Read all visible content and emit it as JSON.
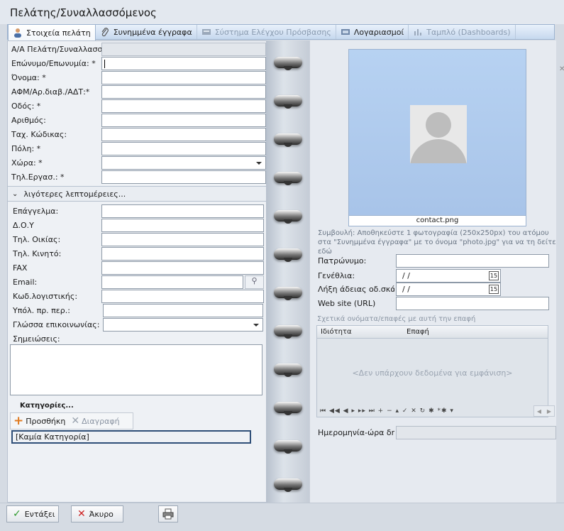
{
  "window": {
    "title": "Πελάτης/Συναλλασσόμενος"
  },
  "tabs": [
    {
      "label": "Στοιχεία πελάτη",
      "icon": "person-icon",
      "active": true
    },
    {
      "label": "Συνημμένα έγγραφα",
      "icon": "paperclip-icon"
    },
    {
      "label": "Σύστημα Ελέγχου Πρόσβασης",
      "icon": "card-reader-icon",
      "disabled": true
    },
    {
      "label": "Λογαριασμοί",
      "icon": "account-icon"
    },
    {
      "label": "Ταμπλό (Dashboards)",
      "icon": "dashboard-icon",
      "disabled": true
    }
  ],
  "main_fields": {
    "id_label": "Α/Α Πελάτη/Συναλλασσόμ",
    "surname_label": "Επώνυμο/Επωνυμία: *",
    "name_label": "Όνομα: *",
    "afm_label": "ΑΦΜ/Αρ.διαβ./ΑΔΤ:*",
    "street_label": "Οδός: *",
    "number_label": "Αριθμός:",
    "zip_label": "Ταχ. Κώδικας:",
    "city_label": "Πόλη: *",
    "country_label": "Χώρα: *",
    "work_phone_label": "Τηλ.Εργασ.: *"
  },
  "details_section": {
    "toggle_label": "λιγότερες λεπτομέρειες...",
    "profession_label": "Επάγγελμα:",
    "doy_label": "Δ.Ο.Υ",
    "home_phone_label": "Τηλ. Οικίας:",
    "mobile_label": "Τηλ. Κινητό:",
    "fax_label": "FAX",
    "email_label": "Email:",
    "accounting_code_label": "Κωδ.λογιστικής:",
    "balance_label": "Υπόλ. πρ. περ.:",
    "language_label": "Γλώσσα επικοινωνίας:",
    "notes_label": "Σημειώσεις:"
  },
  "categories": {
    "header": "Κατηγορίες...",
    "add_label": "Προσθήκη",
    "delete_label": "Διαγραφή",
    "items": [
      "[Καμία Κατηγορία]"
    ]
  },
  "photo": {
    "caption": "contact.png",
    "tip": "Συμβουλή: Αποθηκεύστε 1 φωτογραφία (250x250px) του ατόμου στα \"Συνημμένα έγγραφα\" με το όνομα \"photo.jpg\" για να τη δείτε εδώ"
  },
  "right_fields": {
    "patronymic_label": "Πατρώνυμο:",
    "birthday_label": "Γενέθλια:",
    "birthday_value": "/ /",
    "license_label": "Λήξη άδειας οδ.σκάφους:",
    "license_value": "/ /",
    "website_label": "Web site (URL)",
    "created_label": "Ημερομηνία-ώρα δημιουργίας"
  },
  "related": {
    "title": "Σχετικά ονόματα/επαφές με αυτή την επαφή",
    "columns": [
      "Ιδιότητα",
      "Επαφή"
    ],
    "empty_text": "<Δεν υπάρχουν δεδομένα για εμφάνιση>",
    "nav_glyphs": "⏮ ◀◀ ◀ ▸ ▸▸ ⏭ + − ▴ ✓ ✕ ↻ ✱ *✱ ▾"
  },
  "actions": {
    "ok_label": "Εντάξει",
    "cancel_label": "Άκυρο"
  },
  "colors": {
    "accent": "#2f4f78",
    "tab_bg": "#c6d8ee",
    "photo_bg": "#b7d2f2"
  }
}
